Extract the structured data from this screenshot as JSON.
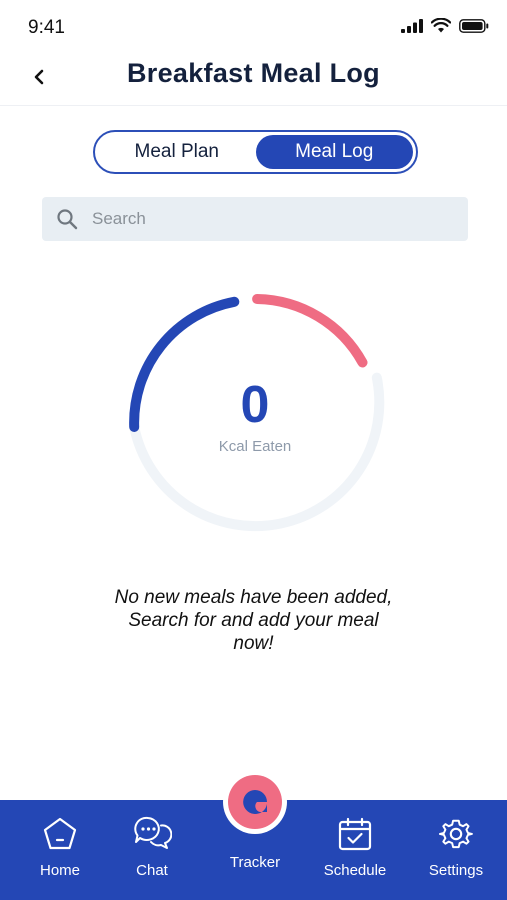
{
  "status": {
    "time": "9:41"
  },
  "header": {
    "title": "Breakfast Meal Log"
  },
  "toggle": {
    "options": [
      "Meal Plan",
      "Meal Log"
    ],
    "selected": "Meal Log"
  },
  "search": {
    "placeholder": "Search",
    "value": ""
  },
  "gauge": {
    "value": "0",
    "label": "Kcal Eaten",
    "colors": {
      "primary": "#2447b5",
      "secondary": "#ef6c83",
      "track": "#f0f4f8"
    }
  },
  "empty_state": {
    "line1": "No new meals have been added,",
    "line2": "Search for and add your meal",
    "line3": "now!"
  },
  "tabbar": {
    "home": "Home",
    "chat": "Chat",
    "tracker": "Tracker",
    "schedule": "Schedule",
    "settings": "Settings",
    "active": "Tracker",
    "colors": {
      "background": "#2447b5",
      "accent": "#ef6c83"
    }
  }
}
